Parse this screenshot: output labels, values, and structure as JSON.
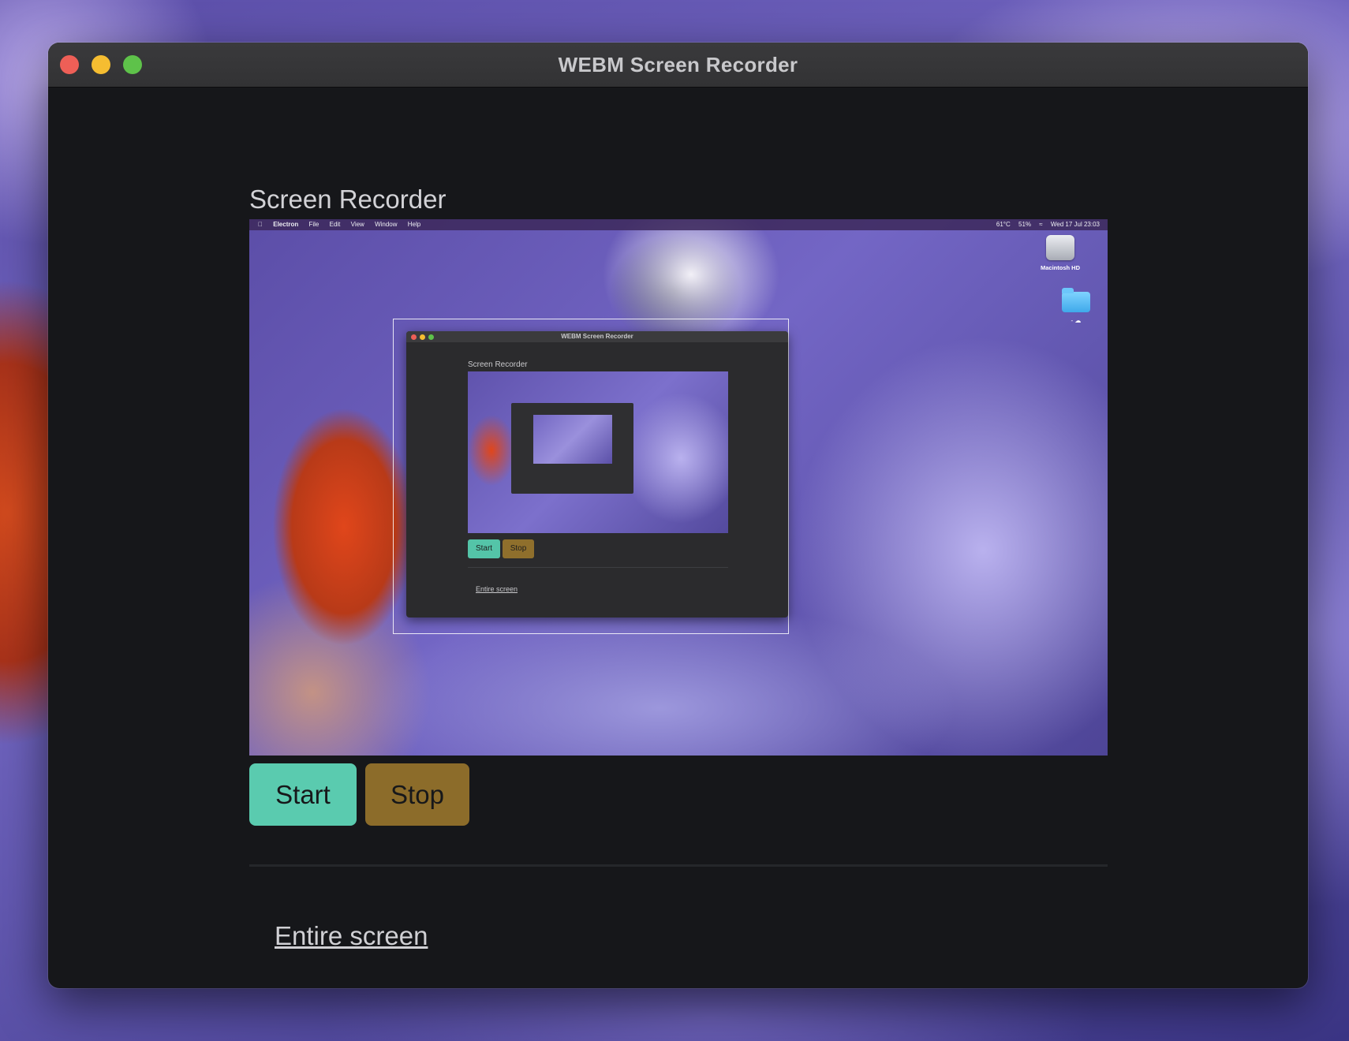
{
  "window": {
    "title": "WEBM Screen Recorder"
  },
  "page": {
    "heading": "Screen Recorder"
  },
  "preview": {
    "menubar": {
      "apple_icon": "apple-icon",
      "app_name": "Electron",
      "menus": [
        "File",
        "Edit",
        "View",
        "Window",
        "Help"
      ],
      "temperature": "61°C",
      "battery": "51%",
      "datetime": "Wed 17 Jul 23:03"
    },
    "desktop": {
      "drive_label": "Macintosh HD",
      "folder_label": "- ☁"
    },
    "nested_window": {
      "title": "WEBM Screen Recorder",
      "heading": "Screen Recorder",
      "start_label": "Start",
      "stop_label": "Stop",
      "source_link": "Entire screen"
    }
  },
  "controls": {
    "start_label": "Start",
    "stop_label": "Stop",
    "start_color": "#5acbaf",
    "stop_color": "#8c6c2a"
  },
  "sources": {
    "selected_label": "Entire screen"
  },
  "colors": {
    "window_background": "#16171a",
    "titlebar": "#3a3a3c",
    "close": "#ee5f57",
    "minimize": "#f5bd31",
    "maximize": "#5ec24a"
  }
}
